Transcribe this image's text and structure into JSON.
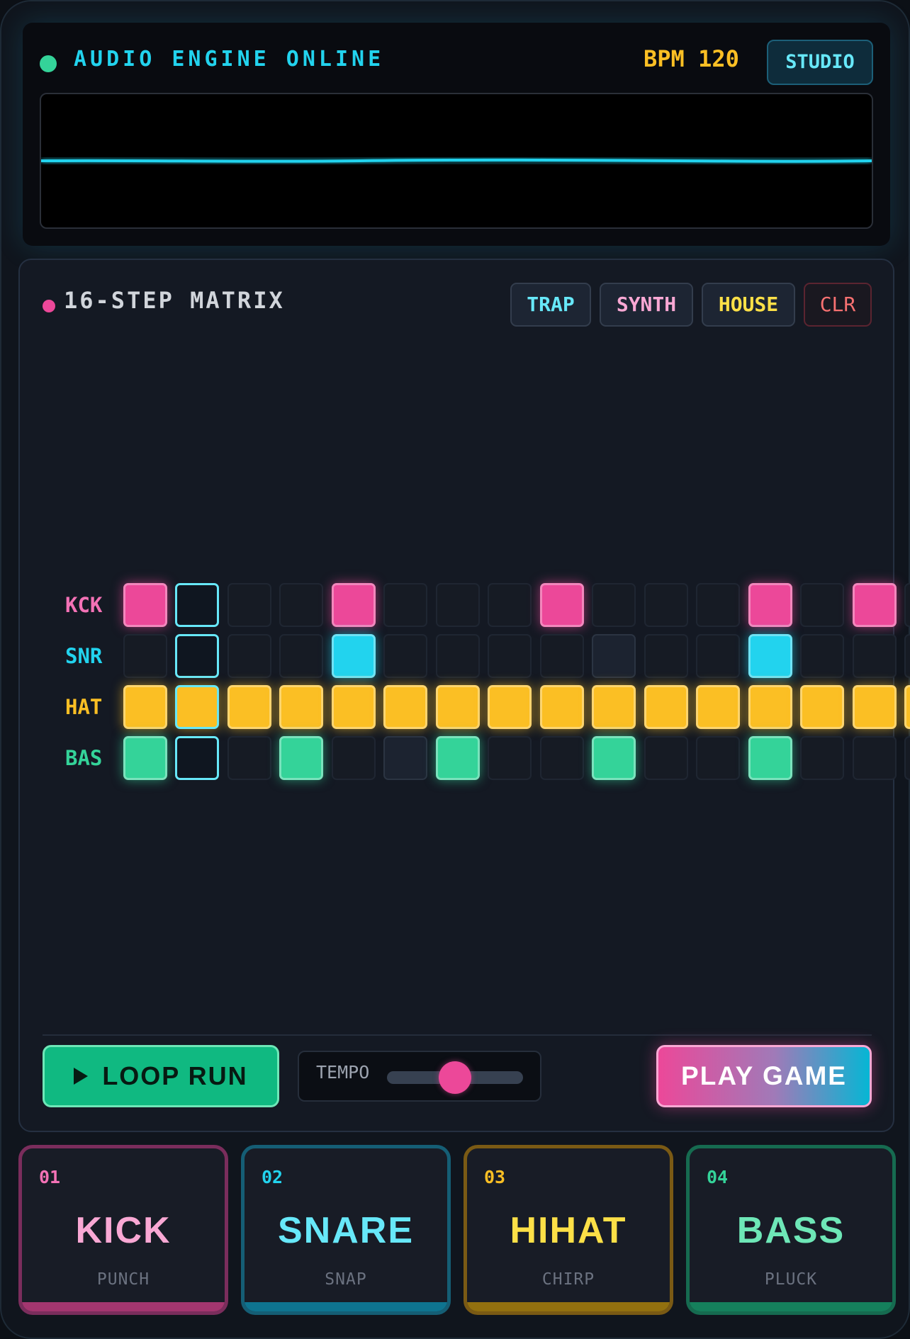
{
  "header": {
    "status_text": "AUDIO ENGINE ONLINE",
    "bpm_text": "BPM 120",
    "mode_button": "STUDIO"
  },
  "matrix": {
    "title": "16-STEP MATRIX",
    "presets": [
      {
        "label": "TRAP"
      },
      {
        "label": "SYNTH"
      },
      {
        "label": "HOUSE"
      },
      {
        "label": "CLR"
      }
    ],
    "current_step": 2,
    "tracks": [
      {
        "label": "KCK",
        "color": "#ec4899",
        "label_color": "#f472b6",
        "steps": [
          1,
          0,
          0,
          0,
          1,
          0,
          0,
          0,
          1,
          0,
          0,
          0,
          1,
          0,
          1,
          0
        ],
        "ghost": []
      },
      {
        "label": "SNR",
        "color": "#22d3ee",
        "label_color": "#22d3ee",
        "steps": [
          0,
          0,
          0,
          0,
          1,
          0,
          0,
          0,
          0,
          0,
          0,
          0,
          1,
          0,
          0,
          0
        ],
        "ghost": [
          1,
          9
        ]
      },
      {
        "label": "HAT",
        "color": "#fbbf24",
        "label_color": "#fbbf24",
        "steps": [
          1,
          1,
          1,
          1,
          1,
          1,
          1,
          1,
          1,
          1,
          1,
          1,
          1,
          1,
          1,
          1
        ],
        "ghost": []
      },
      {
        "label": "BAS",
        "color": "#34d399",
        "label_color": "#34d399",
        "steps": [
          1,
          0,
          0,
          1,
          0,
          0,
          1,
          0,
          0,
          1,
          0,
          0,
          1,
          0,
          0,
          0
        ],
        "ghost": [
          5,
          9
        ]
      }
    ]
  },
  "transport": {
    "loop_label": "LOOP RUN",
    "tempo_label": "TEMPO",
    "tempo_value": 0.5,
    "play_label": "PLAY GAME"
  },
  "pads": [
    {
      "num": "01",
      "name": "KICK",
      "sub": "PUNCH",
      "color": "#f9a8d4",
      "num_color": "#f472b6",
      "border": "#7a2d5c",
      "bar": "#a3366f"
    },
    {
      "num": "02",
      "name": "SNARE",
      "sub": "SNAP",
      "color": "#67e8f9",
      "num_color": "#22d3ee",
      "border": "#155e75",
      "bar": "#0e7490"
    },
    {
      "num": "03",
      "name": "HIHAT",
      "sub": "CHIRP",
      "color": "#fde047",
      "num_color": "#fbbf24",
      "border": "#7a5a14",
      "bar": "#92700f"
    },
    {
      "num": "04",
      "name": "BASS",
      "sub": "PLUCK",
      "color": "#6ee7b7",
      "num_color": "#34d399",
      "border": "#166b50",
      "bar": "#15805c"
    }
  ]
}
